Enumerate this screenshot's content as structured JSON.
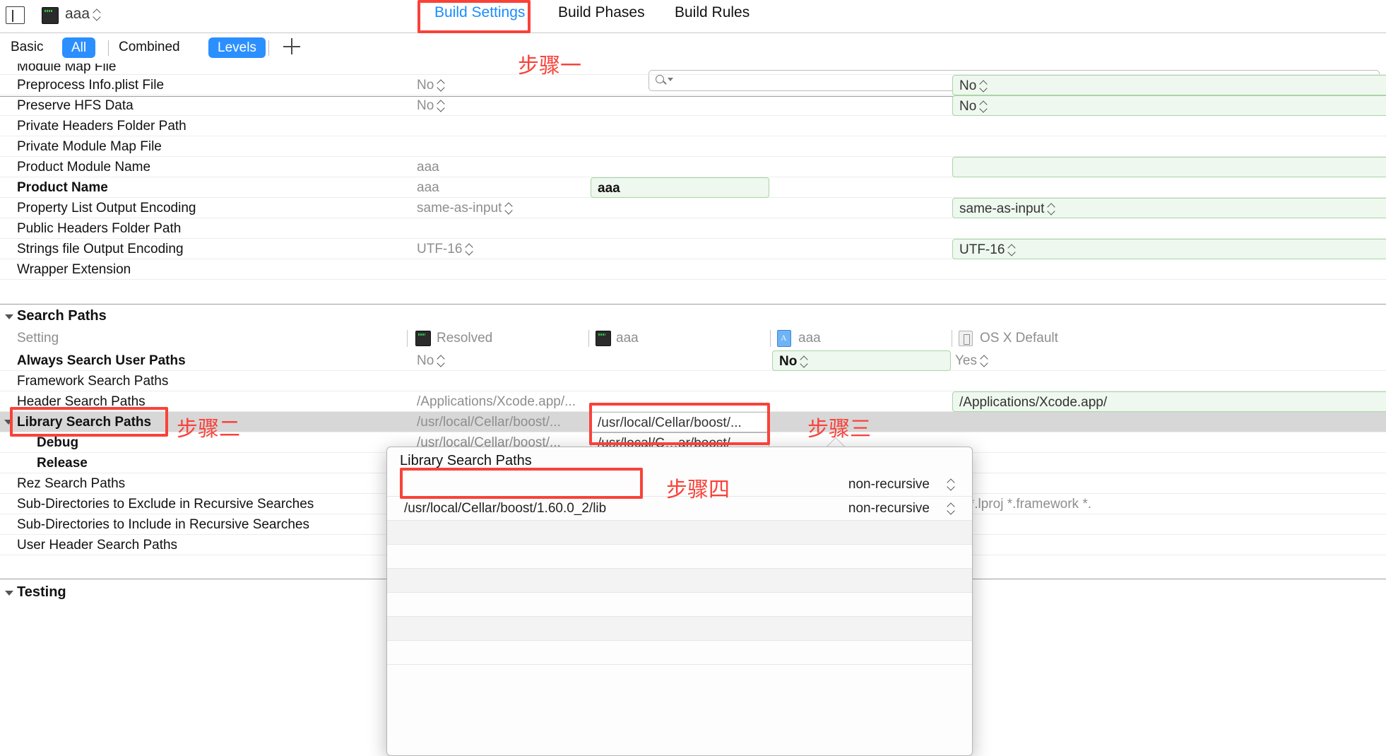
{
  "window": {
    "target_selector": {
      "label": "aaa",
      "icon": "target-icon"
    },
    "panel_toggle_icon": "sidebar-toggle-icon"
  },
  "tabs": [
    {
      "id": "build-settings",
      "label": "Build Settings",
      "active": true
    },
    {
      "id": "build-phases",
      "label": "Build Phases",
      "active": false
    },
    {
      "id": "build-rules",
      "label": "Build Rules",
      "active": false
    }
  ],
  "filterbar": {
    "basic": "Basic",
    "all": "All",
    "combined": "Combined",
    "levels": "Levels",
    "add_label": "+",
    "search_placeholder": ""
  },
  "columns": {
    "setting": "Setting",
    "resolved": "Resolved",
    "target": "aaa",
    "project": "aaa",
    "default": "OS X Default"
  },
  "rows_top": [
    {
      "name": "Module Map File",
      "resolved": "",
      "target": "",
      "project": "",
      "default": "",
      "bold": false,
      "clipped": true
    },
    {
      "name": "Preprocess Info.plist File",
      "resolved": "No",
      "stepper": true,
      "target": "",
      "project": "",
      "default": "No",
      "default_stepper": true,
      "bold": false
    },
    {
      "name": "Preserve HFS Data",
      "resolved": "No",
      "stepper": true,
      "target": "",
      "project": "",
      "default": "No",
      "default_stepper": true,
      "bold": false
    },
    {
      "name": "Private Headers Folder Path",
      "resolved": "",
      "target": "",
      "project": "",
      "default": "",
      "bold": false
    },
    {
      "name": "Private Module Map File",
      "resolved": "",
      "target": "",
      "project": "",
      "default": "",
      "bold": false
    },
    {
      "name": "Product Module Name",
      "resolved": "aaa",
      "target": "",
      "project": "",
      "default": "",
      "bold": false
    },
    {
      "name": "Product Name",
      "resolved": "aaa",
      "target": "aaa",
      "project": "",
      "default": "",
      "bold": true
    },
    {
      "name": "Property List Output Encoding",
      "resolved": "same-as-input",
      "stepper": true,
      "target": "",
      "project": "",
      "default": "same-as-input",
      "default_stepper": true,
      "bold": false
    },
    {
      "name": "Public Headers Folder Path",
      "resolved": "",
      "target": "",
      "project": "",
      "default": "",
      "bold": false
    },
    {
      "name": "Strings file Output Encoding",
      "resolved": "UTF-16",
      "stepper": true,
      "target": "",
      "project": "",
      "default": "UTF-16",
      "default_stepper": true,
      "bold": false
    },
    {
      "name": "Wrapper Extension",
      "resolved": "",
      "target": "",
      "project": "",
      "default": "",
      "bold": false
    }
  ],
  "search_paths_section": {
    "title": "Search Paths",
    "rows": [
      {
        "name": "Always Search User Paths",
        "resolved": "No",
        "stepper": true,
        "target": "",
        "project": "No",
        "project_editable": true,
        "default": "Yes",
        "default_stepper": true,
        "bold": true
      },
      {
        "name": "Framework Search Paths",
        "resolved": "",
        "target": "",
        "project": "",
        "default": "",
        "bold": false
      },
      {
        "name": "Header Search Paths",
        "resolved": "/Applications/Xcode.app/...",
        "target": "",
        "project": "",
        "default": "/Applications/Xcode.app/",
        "default_editable": true,
        "bold": false
      },
      {
        "name": "Library Search Paths",
        "resolved": "/usr/local/Cellar/boost/...",
        "target": "/usr/local/Cellar/boost/...",
        "target_editable": true,
        "project": "",
        "default": "",
        "bold": true,
        "selected": true,
        "expandable": true
      },
      {
        "name": "Debug",
        "resolved": "/usr/local/Cellar/boost/...",
        "target": "/usr/local/C…ar/boost/",
        "target_editable": true,
        "project": "",
        "default": "",
        "bold": true,
        "indent": true
      },
      {
        "name": "Release",
        "resolved": "",
        "target": "",
        "project": "",
        "default": "",
        "bold": true,
        "indent": true
      },
      {
        "name": "Rez Search Paths",
        "resolved": "",
        "target": "",
        "project": "",
        "default": "",
        "bold": false
      },
      {
        "name": "Sub-Directories to Exclude in Recursive Searches",
        "resolved": "",
        "target": "",
        "project": "",
        "default": "b *.lproj *.framework *.",
        "bold": false
      },
      {
        "name": "Sub-Directories to Include in Recursive Searches",
        "resolved": "",
        "target": "",
        "project": "",
        "default": "",
        "bold": false
      },
      {
        "name": "User Header Search Paths",
        "resolved": "",
        "target": "",
        "project": "",
        "default": "",
        "bold": false
      }
    ]
  },
  "testing_section": {
    "title": "Testing"
  },
  "popup": {
    "title": "Library Search Paths",
    "entries": [
      {
        "path": "",
        "mode": "non-recursive"
      },
      {
        "path": "/usr/local/Cellar/boost/1.60.0_2/lib",
        "mode": "non-recursive"
      },
      {
        "path": "",
        "mode": ""
      },
      {
        "path": "",
        "mode": ""
      },
      {
        "path": "",
        "mode": ""
      },
      {
        "path": "",
        "mode": ""
      },
      {
        "path": "",
        "mode": ""
      },
      {
        "path": "",
        "mode": ""
      }
    ]
  },
  "annotations": [
    {
      "id": "step-1",
      "text": "步骤一"
    },
    {
      "id": "step-2",
      "text": "步骤二"
    },
    {
      "id": "step-3",
      "text": "步骤三"
    },
    {
      "id": "step-4",
      "text": "步骤四"
    }
  ],
  "colors": {
    "accent_blue": "#2b8fff",
    "annotation_red": "#f9423a",
    "edit_green_bg": "#eef8ee",
    "edit_green_border": "#a9d4a9",
    "selected_row": "#d7d7d7"
  }
}
